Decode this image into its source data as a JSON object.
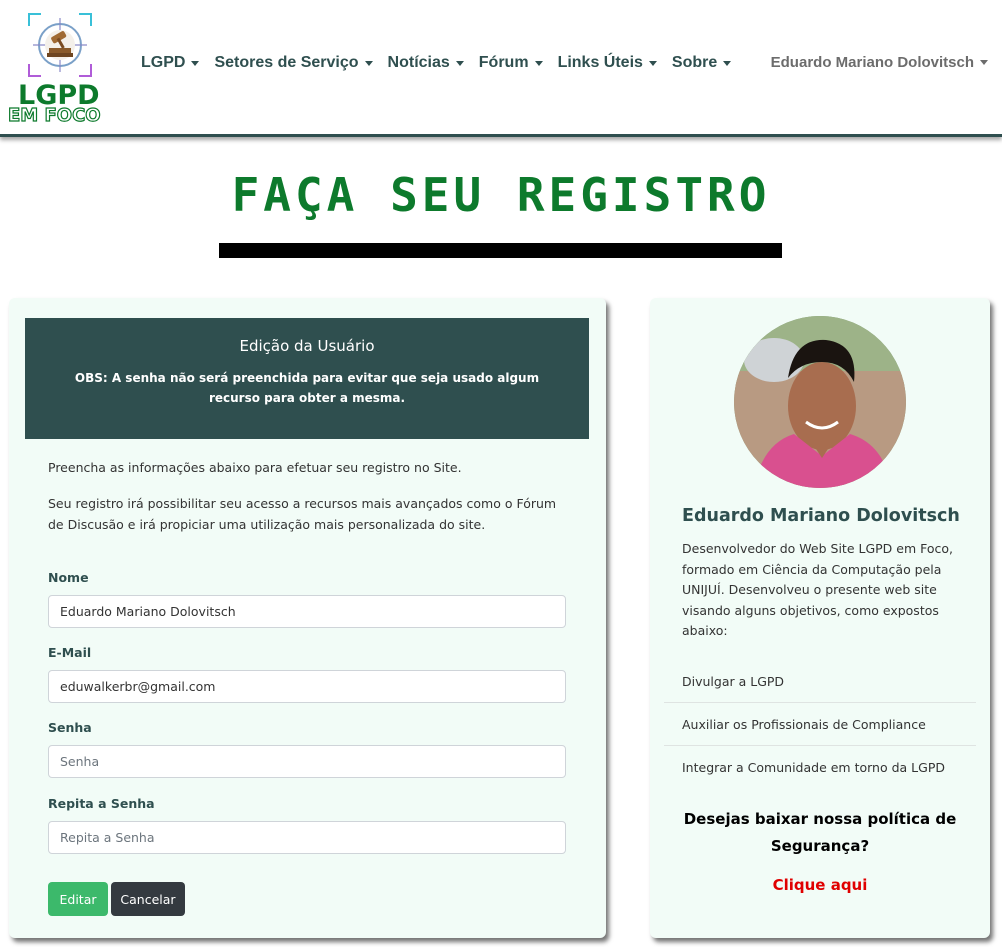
{
  "brand": {
    "logo_line1": "LGPD",
    "logo_line2": "EM FOCO"
  },
  "nav": {
    "items": [
      {
        "label": "LGPD"
      },
      {
        "label": "Setores de Serviço"
      },
      {
        "label": "Notícias"
      },
      {
        "label": "Fórum"
      },
      {
        "label": "Links Úteis"
      },
      {
        "label": "Sobre"
      }
    ],
    "user_label": "Eduardo Mariano Dolovitsch"
  },
  "page": {
    "title": "FAÇA SEU REGISTRO"
  },
  "form_card": {
    "header_title": "Edição da Usuário",
    "header_note": "OBS: A senha não será preenchida para evitar que seja usado algum recurso para obter a mesma.",
    "intro_1": "Preencha as informações abaixo para efetuar seu registro no Site.",
    "intro_2": "Seu registro irá possibilitar seu acesso a recursos mais avançados como o Fórum de Discusão e irá propiciar uma utilização mais personalizada do site.",
    "fields": {
      "name": {
        "label": "Nome",
        "value": "Eduardo Mariano Dolovitsch"
      },
      "email": {
        "label": "E-Mail",
        "value": "eduwalkerbr@gmail.com"
      },
      "password": {
        "label": "Senha",
        "placeholder": "Senha"
      },
      "password_repeat": {
        "label": "Repita a Senha",
        "placeholder": "Repita a Senha"
      }
    },
    "buttons": {
      "edit": "Editar",
      "cancel": "Cancelar"
    }
  },
  "profile_card": {
    "name": "Eduardo Mariano Dolovitsch",
    "bio": "Desenvolvedor do Web Site LGPD em Foco, formado em Ciência da Computação pela UNIJUÍ. Desenvolveu o presente web site visando alguns objetivos, como expostos abaixo:",
    "goals": [
      "Divulgar a LGPD",
      "Auxiliar os Profissionais de Compliance",
      "Integrar a Comunidade em torno da LGPD"
    ],
    "download_question": "Desejas baixar nossa política de Segurança?",
    "download_link": "Clique aqui"
  },
  "colors": {
    "brand_green": "#0d7a2c",
    "dark_slate": "#2f4f4f",
    "card_bg": "#f2fcf7",
    "edit_button": "#3cb96b",
    "cancel_button": "#343a40",
    "link_red": "#e00000"
  }
}
